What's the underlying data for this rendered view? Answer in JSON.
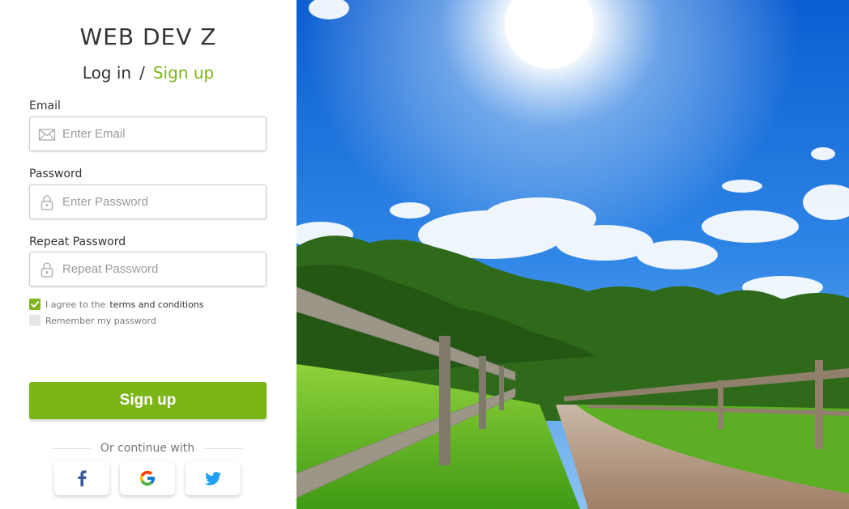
{
  "brand": {
    "logo_text": "WEB DEV Z"
  },
  "auth": {
    "login_label": "Log in",
    "separator": "/",
    "signup_label": "Sign up"
  },
  "form": {
    "email": {
      "label": "Email",
      "placeholder": "Enter Email",
      "value": ""
    },
    "password": {
      "label": "Password",
      "placeholder": "Enter Password",
      "value": ""
    },
    "repeat_password": {
      "label": "Repeat Password",
      "placeholder": "Repeat Password",
      "value": ""
    },
    "terms": {
      "prefix": "I agree to the",
      "link": "terms and conditions",
      "checked": true
    },
    "remember": {
      "label": "Remember my password",
      "checked": false
    },
    "submit_label": "Sign up"
  },
  "social": {
    "divider_text": "Or continue with",
    "providers": [
      {
        "name": "facebook",
        "icon": "facebook-icon",
        "color": "#3b5998"
      },
      {
        "name": "google",
        "icon": "google-icon",
        "color": "#4285f4"
      },
      {
        "name": "twitter",
        "icon": "twitter-icon",
        "color": "#1da1f2"
      }
    ]
  },
  "colors": {
    "accent": "#7cb518",
    "text": "#333333",
    "muted": "#9a9a9a"
  },
  "hero_image": {
    "icon": "landscape-photo"
  }
}
